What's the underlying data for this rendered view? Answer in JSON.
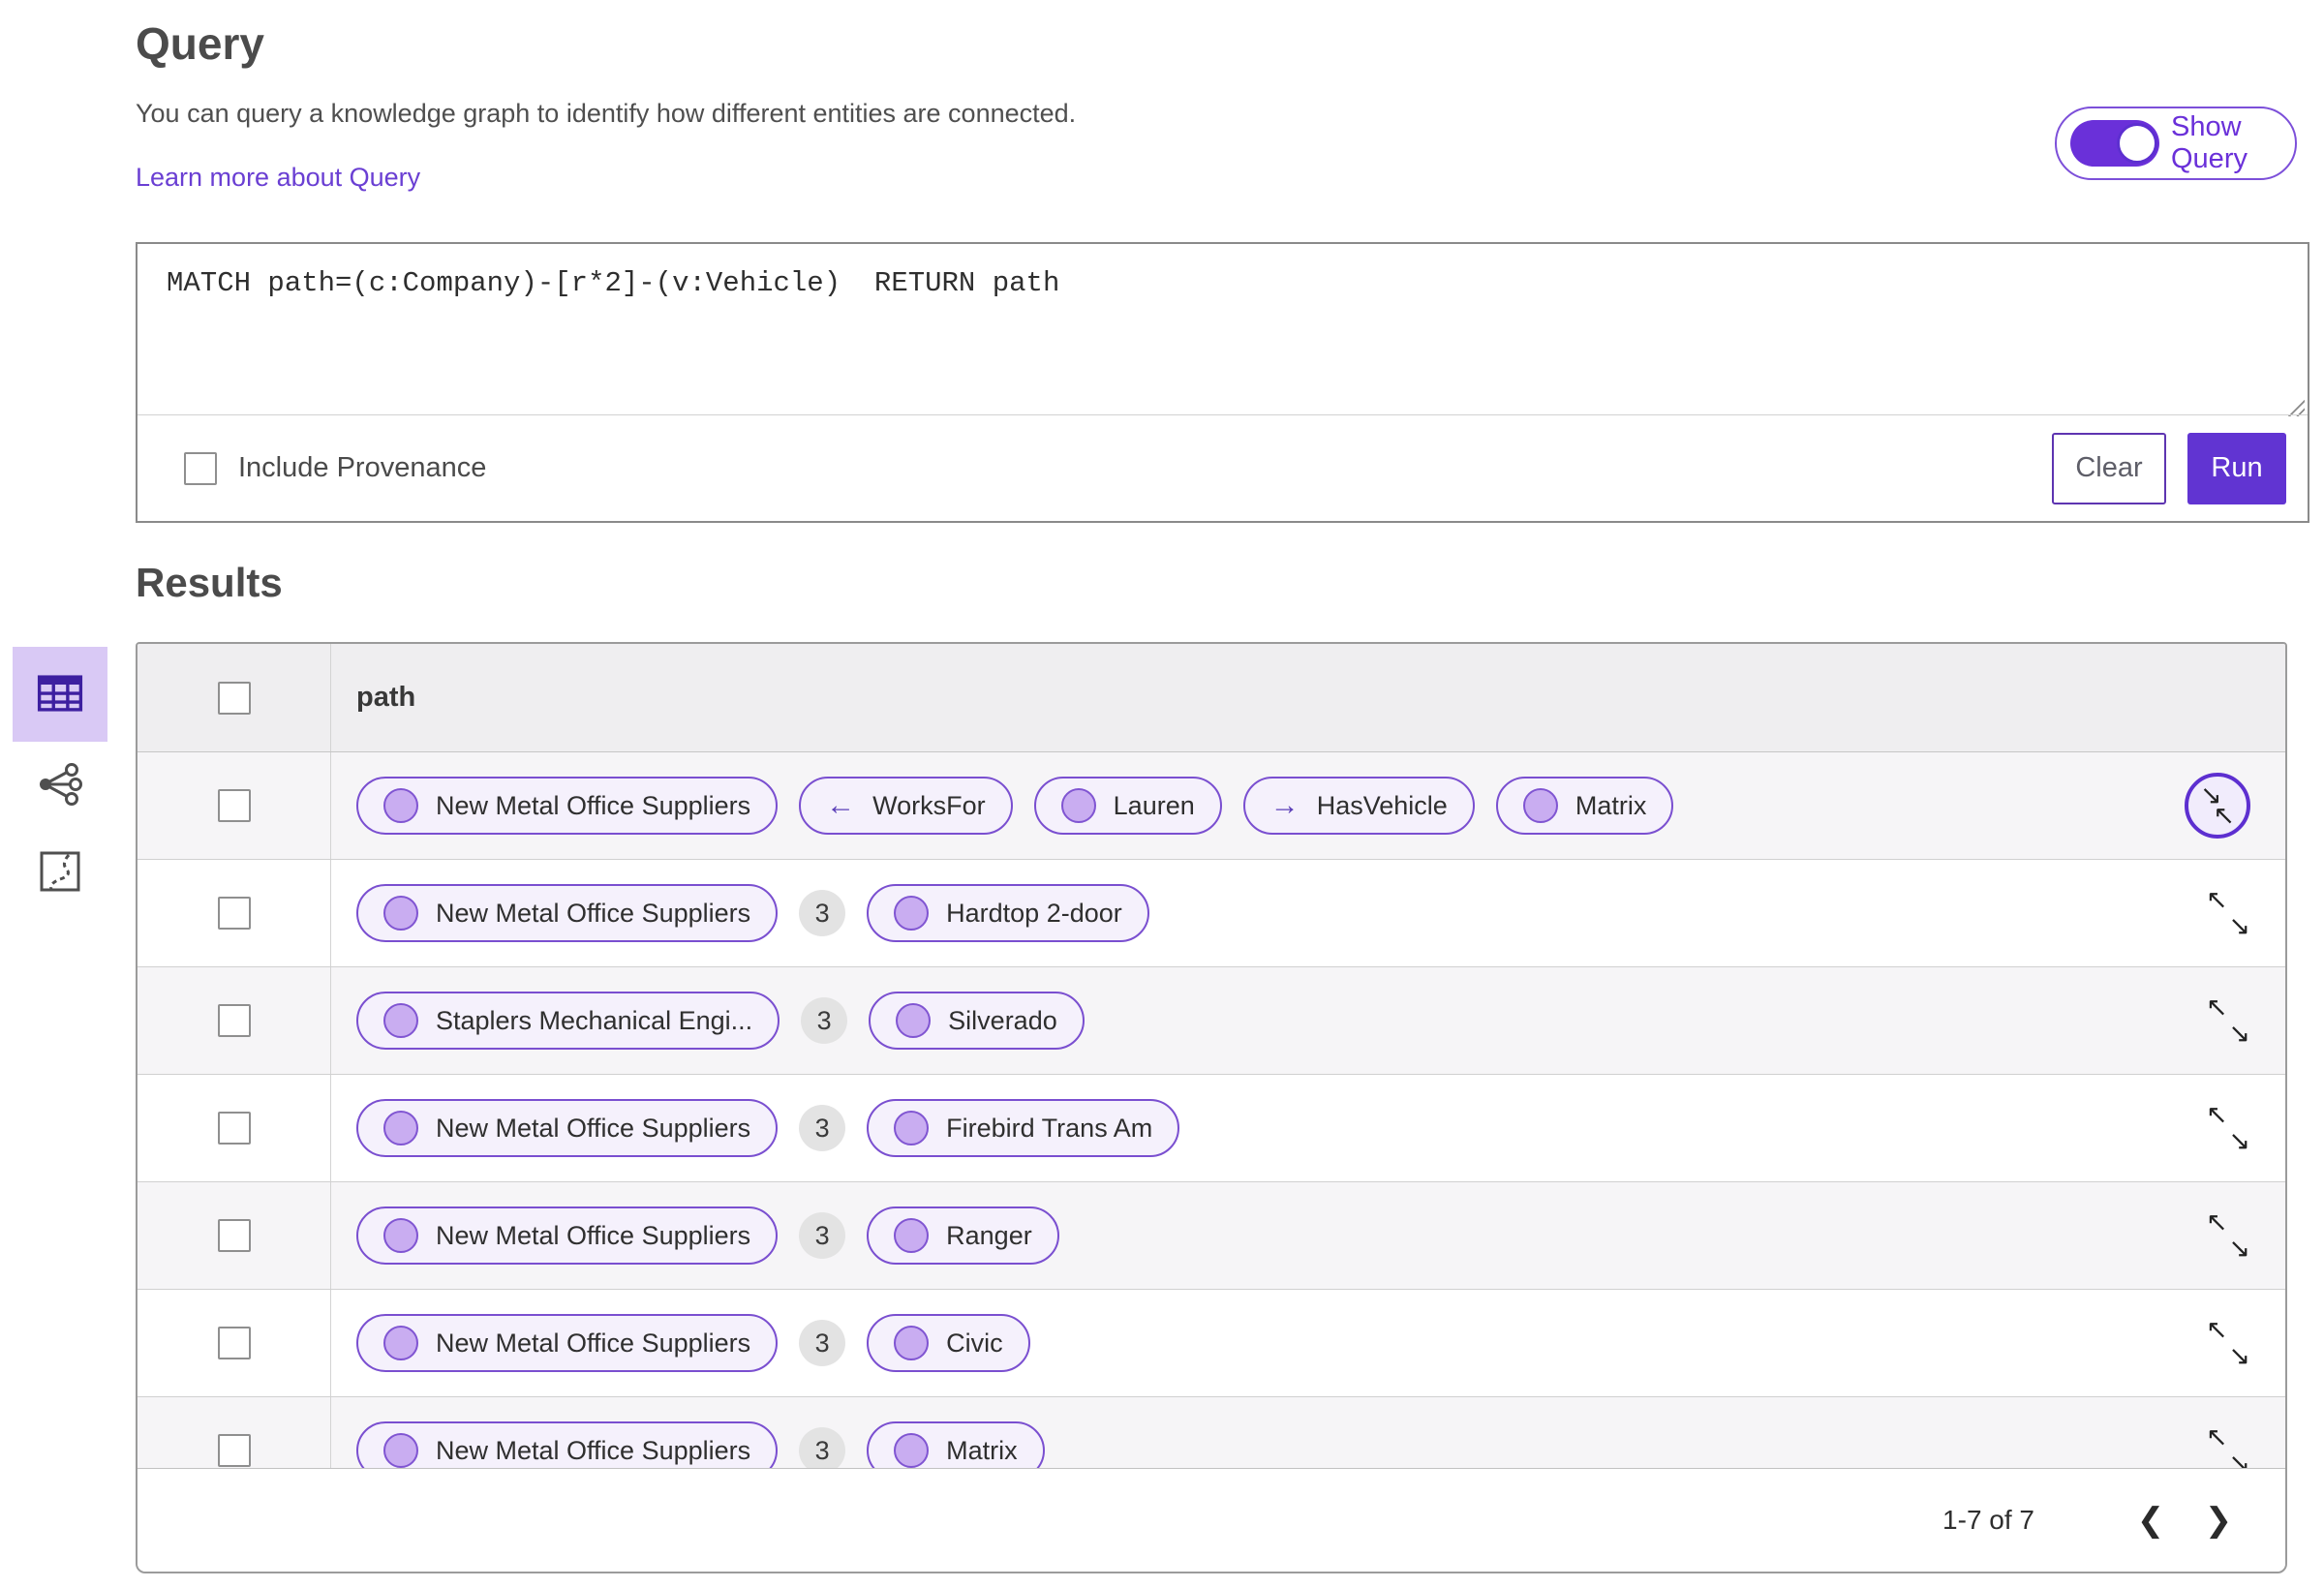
{
  "query_panel": {
    "title": "Query",
    "description": "You can query a knowledge graph to identify how different entities are connected.",
    "learn_more_label": "Learn more about Query",
    "show_query_label": "Show Query",
    "show_query_on": true,
    "query_text": "MATCH path=(c:Company)-[r*2]-(v:Vehicle)  RETURN path",
    "include_provenance_label": "Include Provenance",
    "include_provenance_checked": false,
    "clear_label": "Clear",
    "run_label": "Run"
  },
  "results": {
    "title": "Results",
    "column_header": "path",
    "rows": [
      {
        "expand": "collapse-circled",
        "cells": [
          {
            "kind": "entity",
            "label": "New Metal Office Suppliers"
          },
          {
            "kind": "rel",
            "dir": "left",
            "label": "WorksFor"
          },
          {
            "kind": "entity",
            "label": "Lauren"
          },
          {
            "kind": "rel",
            "dir": "right",
            "label": "HasVehicle"
          },
          {
            "kind": "entity",
            "label": "Matrix"
          }
        ]
      },
      {
        "expand": "expand",
        "cells": [
          {
            "kind": "entity",
            "label": "New Metal Office Suppliers"
          },
          {
            "kind": "count",
            "label": "3"
          },
          {
            "kind": "entity",
            "label": "Hardtop 2-door"
          }
        ]
      },
      {
        "expand": "expand",
        "cells": [
          {
            "kind": "entity",
            "label": "Staplers Mechanical Engi..."
          },
          {
            "kind": "count",
            "label": "3"
          },
          {
            "kind": "entity",
            "label": "Silverado"
          }
        ]
      },
      {
        "expand": "expand",
        "cells": [
          {
            "kind": "entity",
            "label": "New Metal Office Suppliers"
          },
          {
            "kind": "count",
            "label": "3"
          },
          {
            "kind": "entity",
            "label": "Firebird Trans Am"
          }
        ]
      },
      {
        "expand": "expand",
        "cells": [
          {
            "kind": "entity",
            "label": "New Metal Office Suppliers"
          },
          {
            "kind": "count",
            "label": "3"
          },
          {
            "kind": "entity",
            "label": "Ranger"
          }
        ]
      },
      {
        "expand": "expand",
        "cells": [
          {
            "kind": "entity",
            "label": "New Metal Office Suppliers"
          },
          {
            "kind": "count",
            "label": "3"
          },
          {
            "kind": "entity",
            "label": "Civic"
          }
        ]
      },
      {
        "expand": "expand",
        "cells": [
          {
            "kind": "entity",
            "label": "New Metal Office Suppliers"
          },
          {
            "kind": "count",
            "label": "3"
          },
          {
            "kind": "entity",
            "label": "Matrix"
          }
        ]
      }
    ],
    "pagination": {
      "range_label": "1-7 of 7",
      "prev_icon": "❮",
      "next_icon": "❯"
    }
  },
  "sidebar": {
    "items": [
      {
        "name": "table-view",
        "selected": true
      },
      {
        "name": "link-chart-view",
        "selected": false
      },
      {
        "name": "map-view",
        "selected": false
      }
    ]
  },
  "icons": {
    "arrow_left": "←",
    "arrow_right": "→",
    "expand_nw": "↖",
    "expand_se": "↘"
  },
  "colors": {
    "accent_purple": "#6a30d9",
    "pill_border": "#7a4fd0",
    "node_fill": "#c9adf1",
    "selected_view_bg": "#d9c9f5",
    "header_bg": "#efeef0",
    "row_alt_bg": "#f6f5f7",
    "badge_bg": "#e3e3e3"
  }
}
